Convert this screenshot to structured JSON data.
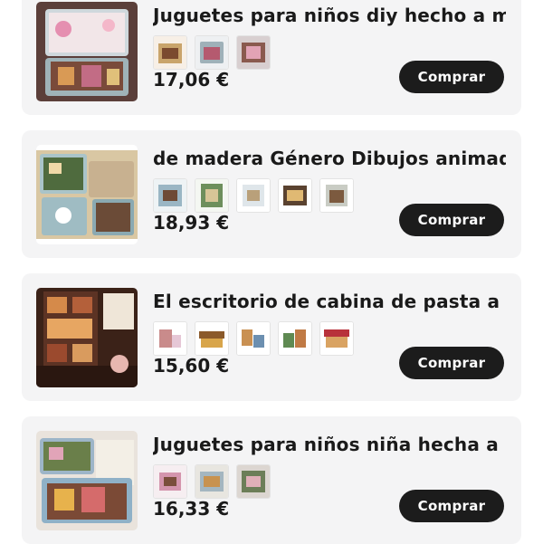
{
  "products": [
    {
      "title": "Juguetes para niños diy hecho a ma...",
      "price": "17,06 €",
      "buy_label": "Comprar",
      "variant_count": 3
    },
    {
      "title": "de madera Género Dibujos animado...",
      "price": "18,93 €",
      "buy_label": "Comprar",
      "variant_count": 5
    },
    {
      "title": "El escritorio de cabina de pasta a m...",
      "price": "15,60 €",
      "buy_label": "Comprar",
      "variant_count": 5
    },
    {
      "title": "Juguetes para niños niña hecha a m...",
      "price": "16,33 €",
      "buy_label": "Comprar",
      "variant_count": 3
    }
  ],
  "colors": {
    "card_background": "#f4f4f5",
    "button_background": "#1c1c1c",
    "button_text": "#ffffff",
    "text": "#1a1a1a"
  }
}
